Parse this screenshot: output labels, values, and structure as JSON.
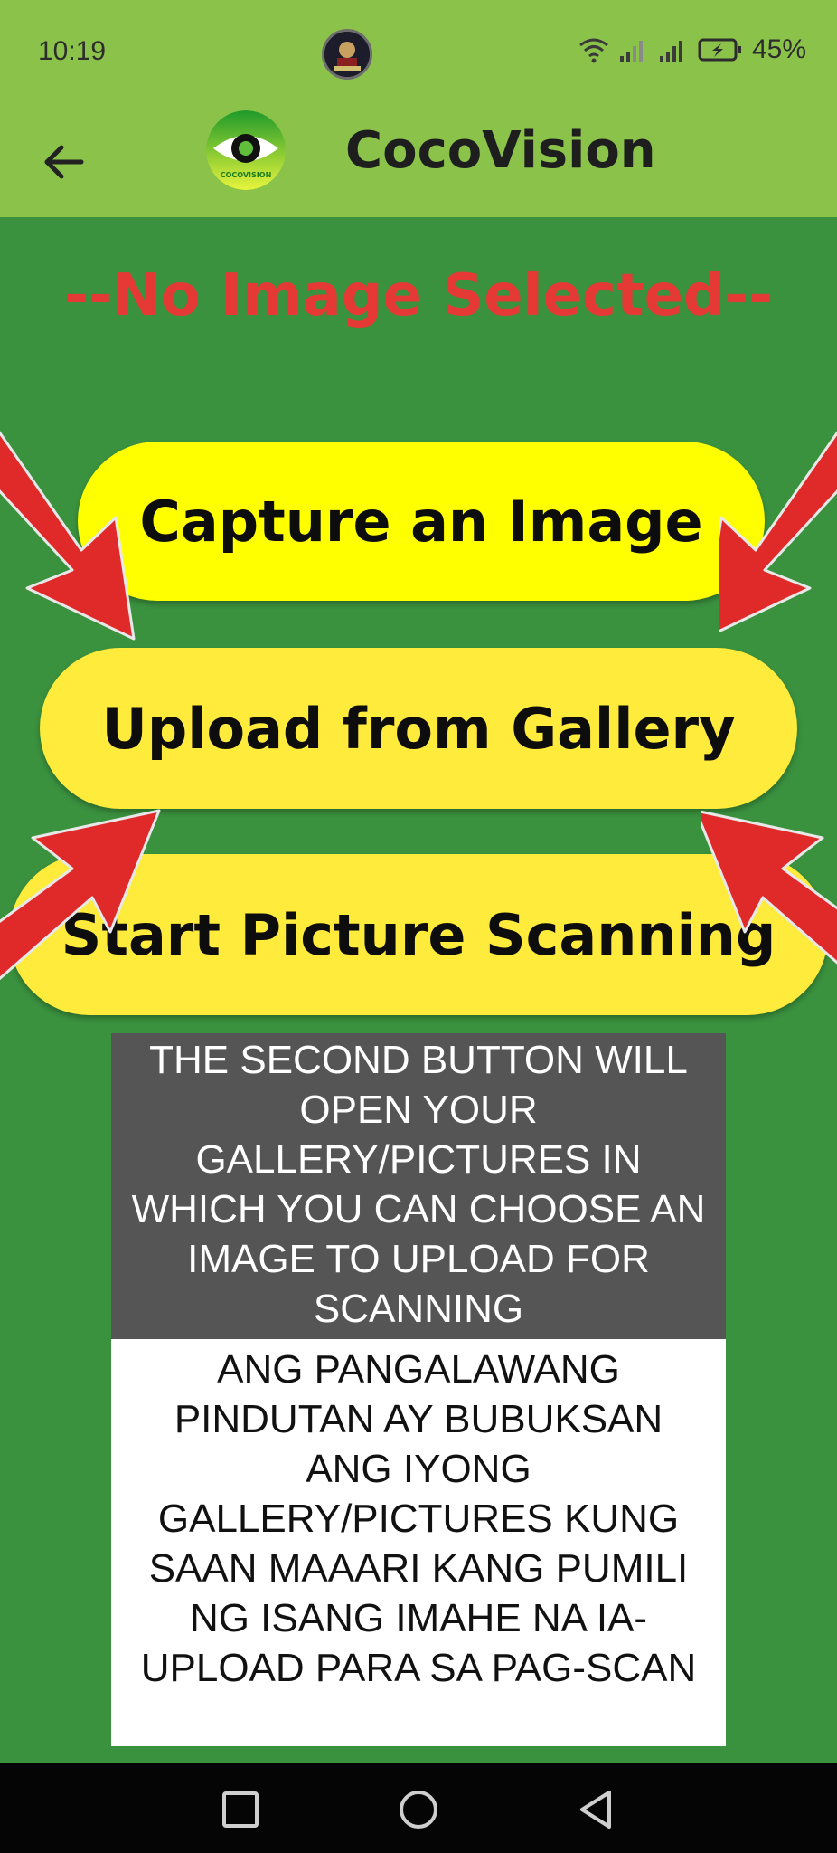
{
  "status_bar": {
    "time": "10:19",
    "battery_percent": "45%",
    "icons": [
      "wifi-icon",
      "signal-icon",
      "signal-icon",
      "battery-charging-icon"
    ]
  },
  "app_bar": {
    "title": "CocoVision",
    "logo_text": "COCOVISION",
    "back_icon": "arrow-left-icon"
  },
  "main": {
    "status_message": "--No Image Selected--",
    "buttons": [
      {
        "label": "Capture an Image"
      },
      {
        "label": "Upload from Gallery"
      },
      {
        "label": "Start Picture Scanning"
      }
    ],
    "info_english": "THE SECOND BUTTON WILL OPEN YOUR GALLERY/PICTURES IN WHICH YOU CAN CHOOSE AN IMAGE TO UPLOAD FOR SCANNING",
    "info_tagalog": "ANG PANGALAWANG PINDUTAN AY BUBUKSAN ANG IYONG GALLERY/PICTURES KUNG SAAN MAAARI KANG PUMILI NG ISANG IMAHE NA IA-UPLOAD PARA SA PAG-SCAN"
  },
  "nav_bar": {
    "icons": [
      "recents-square-icon",
      "home-circle-icon",
      "back-triangle-icon"
    ]
  },
  "colors": {
    "app_bar": "#8bc34a",
    "background": "#3a913e",
    "status_message": "#e53935",
    "capture_button": "#ffff00",
    "buttons": "#ffeb3b",
    "arrows": "#e53935",
    "info_english_bg": "#555555",
    "info_tagalog_bg": "#ffffff"
  }
}
